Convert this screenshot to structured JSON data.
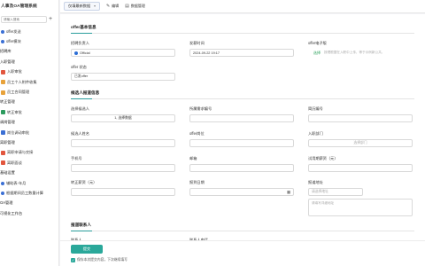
{
  "sidebar": {
    "title": "人事及OA管理系统",
    "search_placeholder": "请输入搜索",
    "add_label": "+",
    "items": [
      {
        "type": "leaf",
        "label": "offer发送",
        "icon": "dot",
        "color": "#3b6fd4"
      },
      {
        "type": "leaf",
        "label": "offer模块",
        "icon": "dot",
        "color": "#3b6fd4"
      },
      {
        "type": "group",
        "label": "招聘库"
      },
      {
        "type": "group",
        "label": "入职管理"
      },
      {
        "type": "leaf",
        "label": "入职审批",
        "icon": "sq",
        "color": "#e2563e"
      },
      {
        "type": "leaf",
        "label": "员工个人附件收集",
        "icon": "sq",
        "color": "#e8a23a"
      },
      {
        "type": "leaf",
        "label": "员工合同管理",
        "icon": "sq",
        "color": "#e8a23a"
      },
      {
        "type": "group",
        "label": "转正管理"
      },
      {
        "type": "leaf",
        "label": "转正审批",
        "icon": "sq",
        "color": "#2c9b5e"
      },
      {
        "type": "group",
        "label": "调岗管理"
      },
      {
        "type": "leaf",
        "label": "岗位调动审批",
        "icon": "sq",
        "color": "#3b6fd4"
      },
      {
        "type": "group",
        "label": "离职管理"
      },
      {
        "type": "leaf",
        "label": "离职申请与交接",
        "icon": "sq",
        "color": "#e2563e"
      },
      {
        "type": "leaf",
        "label": "离职面谈",
        "icon": "sq",
        "color": "#e2563e"
      },
      {
        "type": "group",
        "label": "基础设置"
      },
      {
        "type": "leaf",
        "label": "辅助表-年月",
        "icon": "dot",
        "color": "#3b6fd4"
      },
      {
        "type": "leaf",
        "label": "根据期间员工数量计算",
        "icon": "dot",
        "color": "#3b6fd4"
      },
      {
        "type": "group",
        "label": "OA管理"
      },
      {
        "type": "group",
        "label": "可视化工作台"
      }
    ]
  },
  "topbar": {
    "tab_label": "仅填最新数据",
    "tab_arrow": "▾",
    "edit_label": "编辑",
    "data_mgmt_label": "数据管理"
  },
  "sections": {
    "basic": "offer基本信息",
    "candidate": "候选人报道信息",
    "contact": "报道联系人"
  },
  "basic": {
    "owner_label": "招聘负责人",
    "owner_value": "Official",
    "send_time_label": "发薪时间",
    "send_time_value": "2024-09-22 19:17",
    "email_label": "offer电子版",
    "email_link": "选择",
    "email_hint": "按理根据在入职中上传，等于示例新公共。",
    "status_label": "offer 状态",
    "status_value": "已发offer"
  },
  "candidate": {
    "select_label": "选择候选人",
    "select_value": "1, 选择数据",
    "demand_label": "所属需求编号",
    "entry_no_label": "简历编号",
    "name_label": "候选人姓名",
    "post_label": "offer岗位",
    "dept_label": "入职部门",
    "dept_placeholder": "选择部门",
    "phone_label": "手机号",
    "email_label": "邮箱",
    "probation_label": "试用期薪资（元）",
    "regular_label": "转正薪资（元）",
    "report_date_label": "报到日期",
    "report_addr_label": "报道地址",
    "addr_placeholder": "请选择地址",
    "addr_detail_placeholder": "请填写详细地址"
  },
  "contact": {
    "name_label": "联系人",
    "phone_label": "联系人电话"
  },
  "footer": {
    "submit_label": "提交",
    "keep_label": "保存本次提交内容，下次继续填写",
    "check_mark": "✓"
  },
  "icons": {
    "edit": "✎",
    "data": "▤",
    "calendar": "▦"
  }
}
